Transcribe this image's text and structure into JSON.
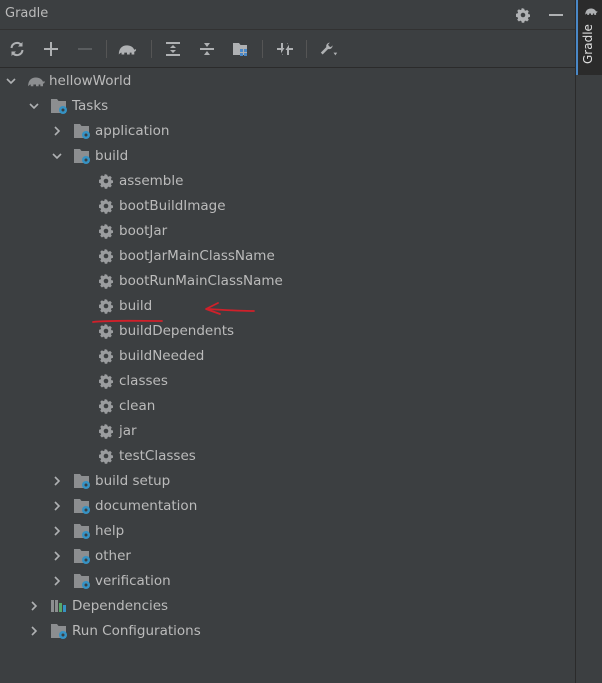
{
  "panel": {
    "title": "Gradle"
  },
  "side_tab": {
    "label": "Gradle"
  },
  "header_icons": [
    "gear-icon",
    "minimize-icon"
  ],
  "toolbar": {
    "buttons": [
      "refresh-icon",
      "add-icon",
      "remove-icon",
      "elephant-icon",
      "expand-all-icon",
      "collapse-all-icon",
      "group-modules-icon",
      "toggle-offline-icon",
      "settings-wrench-icon"
    ]
  },
  "tree": {
    "root": "hellowWorld",
    "tasks": "Tasks",
    "groups": {
      "application": "application",
      "build": "build",
      "build_setup": "build setup",
      "documentation": "documentation",
      "help": "help",
      "other": "other",
      "verification": "verification"
    },
    "build_tasks": [
      "assemble",
      "bootBuildImage",
      "bootJar",
      "bootJarMainClassName",
      "bootRunMainClassName",
      "build",
      "buildDependents",
      "buildNeeded",
      "classes",
      "clean",
      "jar",
      "testClasses"
    ],
    "dependencies": "Dependencies",
    "run_configurations": "Run Configurations"
  },
  "colors": {
    "background": "#3c3f41",
    "text": "#bbbbbb",
    "accent": "#4a88c7",
    "annotation": "#d0202a"
  }
}
